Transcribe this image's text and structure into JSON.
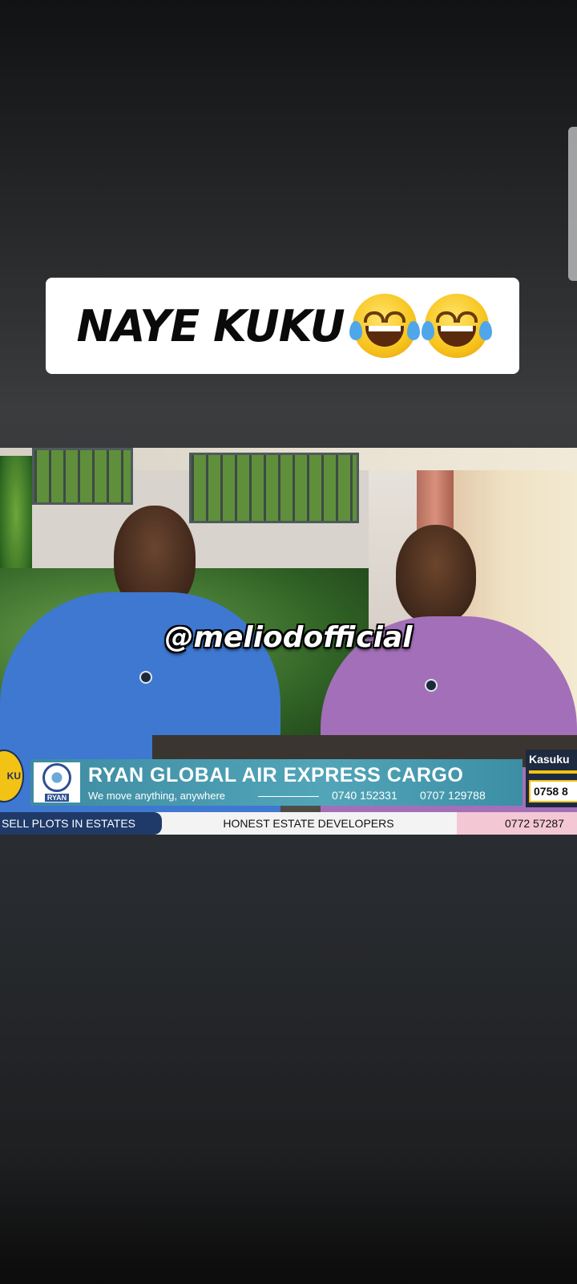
{
  "caption": {
    "text": "NAYE KUKU",
    "emojis": [
      "face-with-tears-of-joy",
      "face-with-tears-of-joy"
    ]
  },
  "video": {
    "watermark": "@meliodofficial",
    "lower_third": {
      "title": "RYAN GLOBAL AIR EXPRESS CARGO",
      "tagline": "We move anything, anywhere",
      "phone_1": "0740 152331",
      "phone_2": "0707 129788",
      "logo_label": "RYAN"
    },
    "side_badge": "KU",
    "right_panel": {
      "title": "Kasuku",
      "phone": "0758 8"
    },
    "ticker": {
      "left": "SELL PLOTS IN ESTATES",
      "middle": "HONEST ESTATE DEVELOPERS",
      "right": "0772 57287"
    }
  },
  "colors": {
    "background": "#2c2e30",
    "lower_third": "#52a5b8",
    "ticker_left": "#1f3a68",
    "accent_yellow": "#f2c314"
  }
}
